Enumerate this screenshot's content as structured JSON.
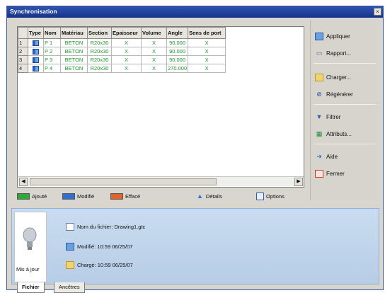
{
  "window": {
    "title": "Synchronisation"
  },
  "grid": {
    "columns": [
      "",
      "Type",
      "Nom",
      "Matériau",
      "Section",
      "Epaisseur",
      "Volume",
      "Angle",
      "Sens de port"
    ],
    "rows": [
      {
        "num": "1",
        "nom": "P 1",
        "materiau": "BETON",
        "section": "R20x30",
        "epaisseur": "X",
        "volume": "X",
        "angle": "90.000",
        "sens": "X"
      },
      {
        "num": "2",
        "nom": "P 2",
        "materiau": "BETON",
        "section": "R20x30",
        "epaisseur": "X",
        "volume": "X",
        "angle": "90.000",
        "sens": "X"
      },
      {
        "num": "3",
        "nom": "P 3",
        "materiau": "BETON",
        "section": "R20x30",
        "epaisseur": "X",
        "volume": "X",
        "angle": "90.000",
        "sens": "X"
      },
      {
        "num": "4",
        "nom": "P 4",
        "materiau": "BETON",
        "section": "R20x30",
        "epaisseur": "X",
        "volume": "X",
        "angle": "270.000",
        "sens": "X"
      }
    ]
  },
  "legend": {
    "added": {
      "label": "Ajouté",
      "color": "#2fa83a"
    },
    "modified": {
      "label": "Modifié",
      "color": "#2f6fd0"
    },
    "deleted": {
      "label": "Effacé",
      "color": "#e0642a"
    },
    "details": "Détails",
    "options": "Options"
  },
  "side": {
    "apply": "Appliquer",
    "report": "Rapport...",
    "load": "Charger...",
    "regenerate": "Régénérer",
    "filter": "Filtrer",
    "attributes": "Attributs...",
    "help": "Aide",
    "close": "Fermer"
  },
  "info": {
    "filename": "Nom du fichier: Drawing1.gtc",
    "modified": "Modifié: 10:59 06/25/07",
    "loaded": "Chargé: 10:59 06/25/07",
    "status": "Mis à jour"
  },
  "tabs": [
    "Fichier",
    "Ancêtres"
  ]
}
